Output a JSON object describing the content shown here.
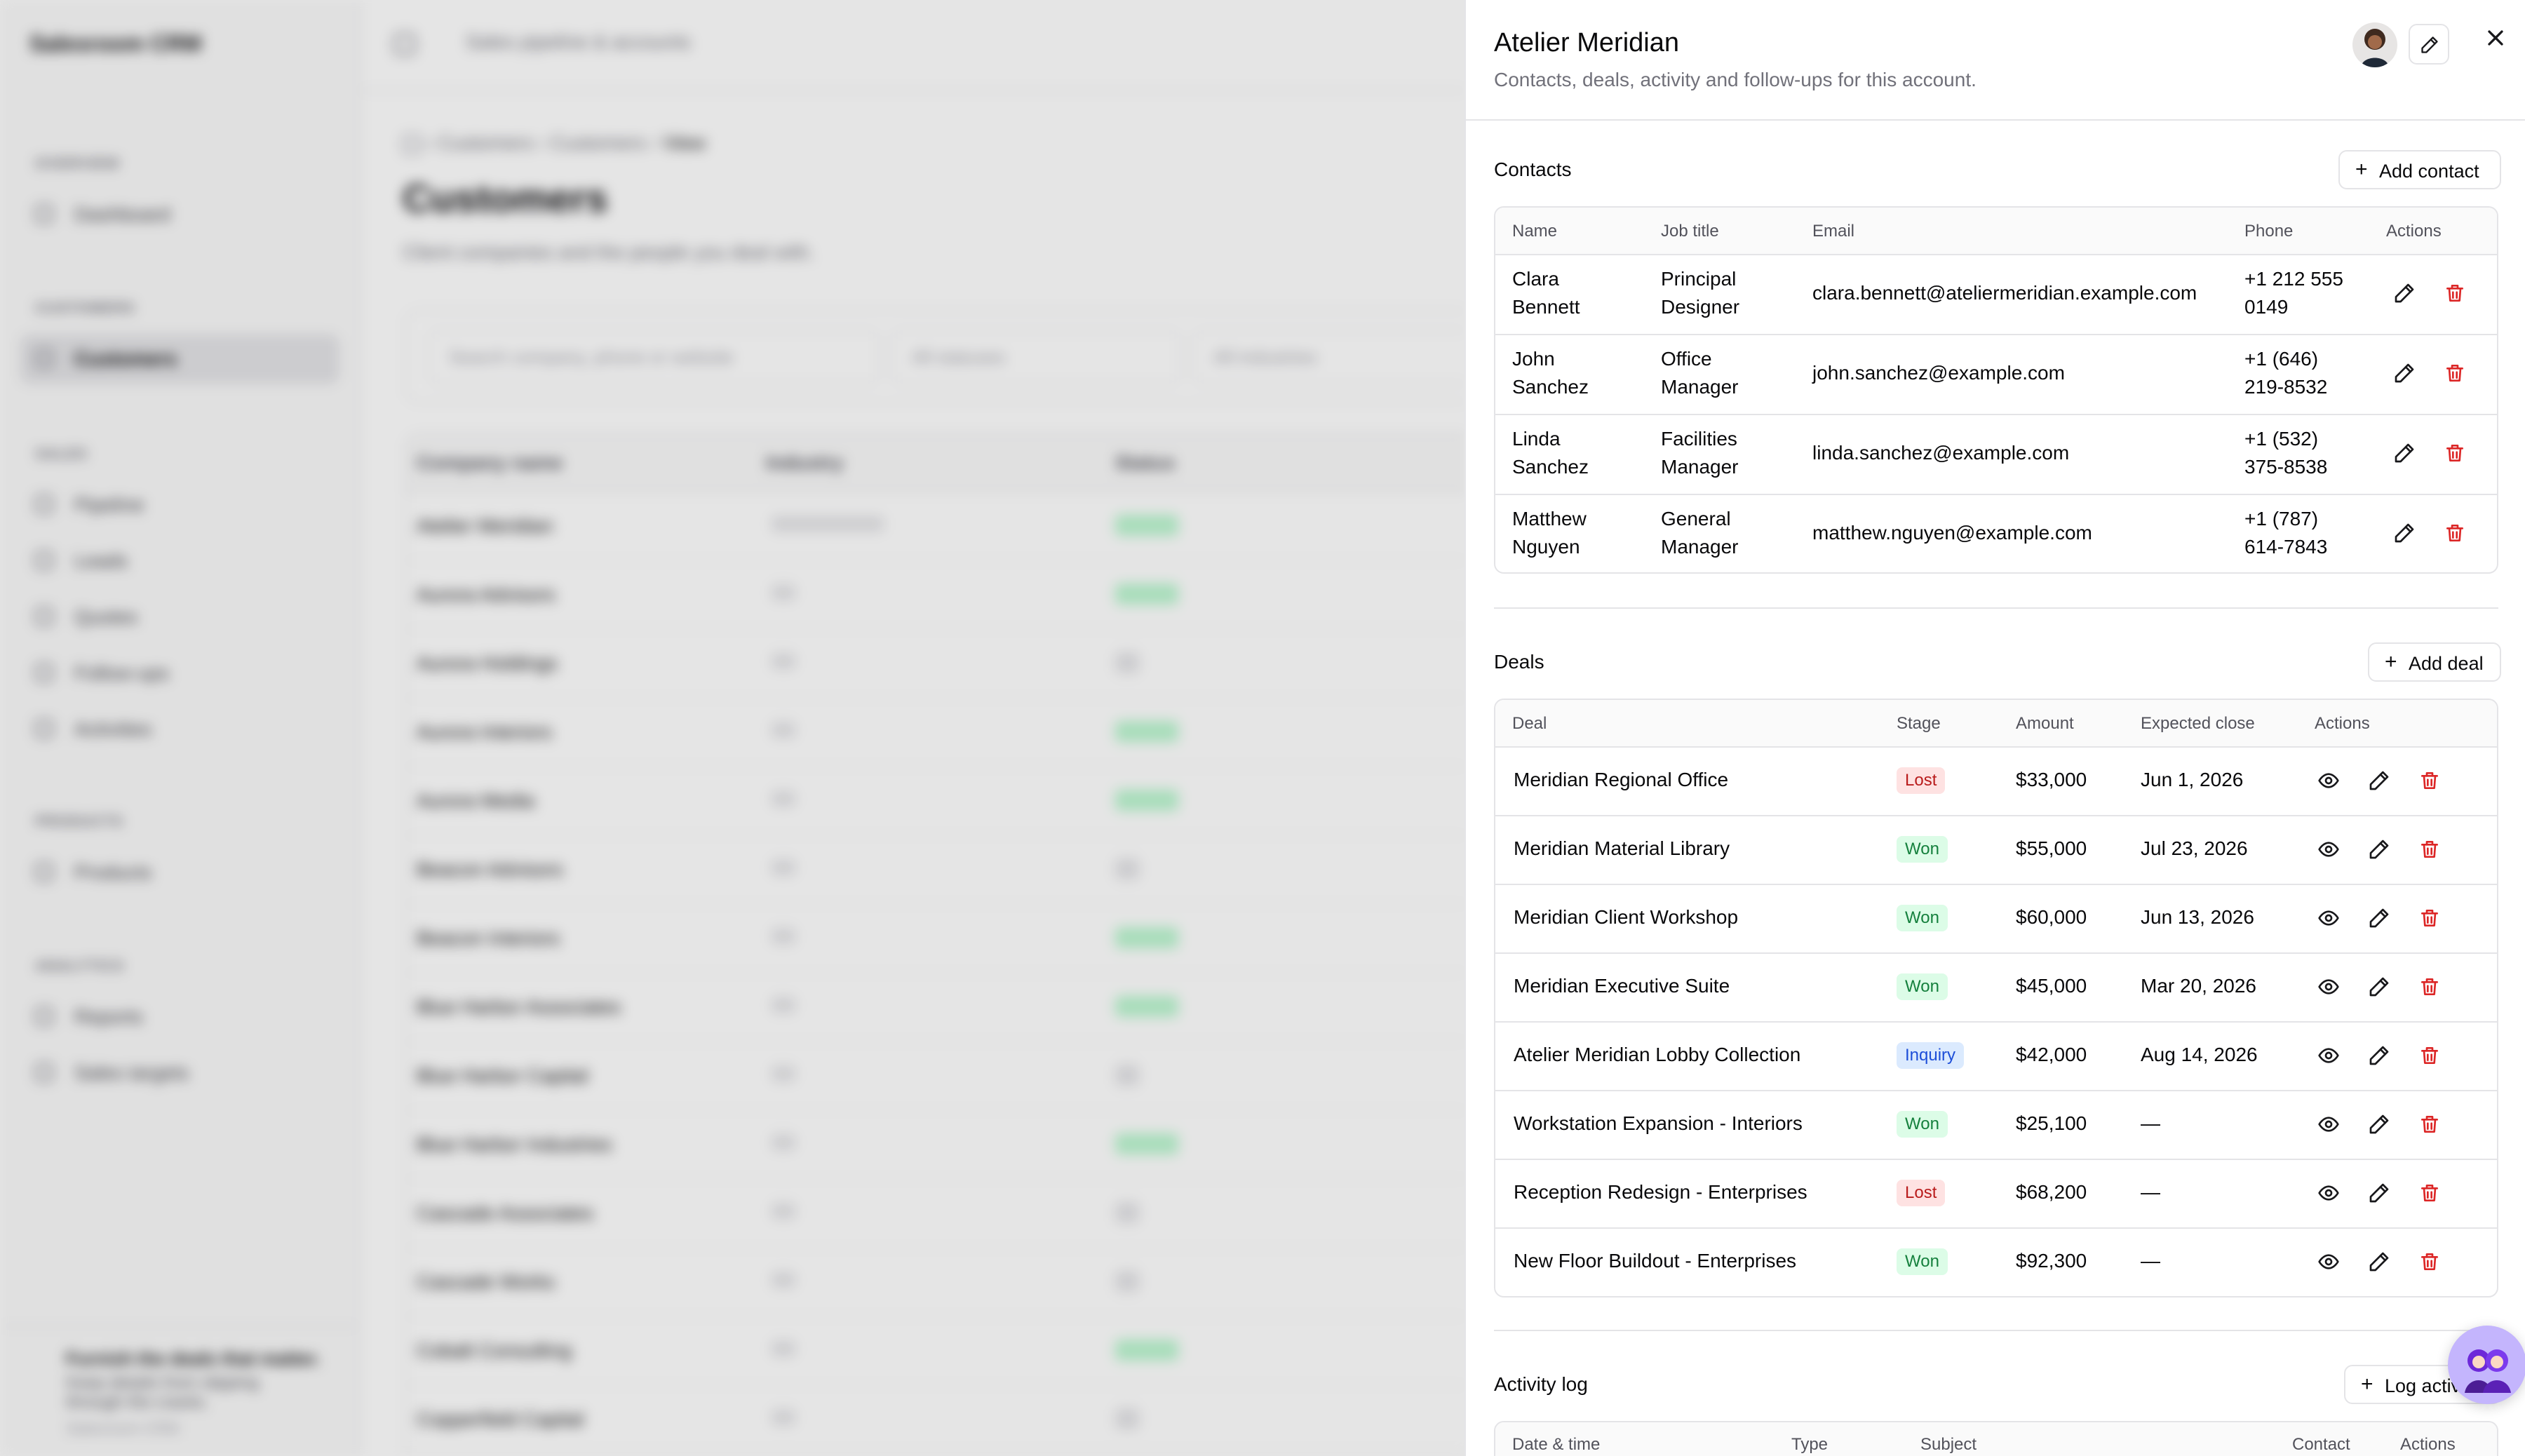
{
  "app": {
    "brand": "Salesroom CRM",
    "topbar_title": "Sales pipeline & accounts",
    "nav": [
      {
        "group": "OVERVIEW",
        "items": [
          {
            "label": "Dashboard",
            "active": false
          }
        ]
      },
      {
        "group": "CUSTOMERS",
        "items": [
          {
            "label": "Customers",
            "active": true
          }
        ]
      },
      {
        "group": "SALES",
        "items": [
          {
            "label": "Pipeline"
          },
          {
            "label": "Leads"
          },
          {
            "label": "Quotes"
          },
          {
            "label": "Follow-ups"
          },
          {
            "label": "Activities"
          }
        ]
      },
      {
        "group": "PRODUCTS",
        "items": [
          {
            "label": "Products"
          }
        ]
      },
      {
        "group": "ANALYTICS",
        "items": [
          {
            "label": "Reports"
          },
          {
            "label": "Sales targets"
          }
        ]
      }
    ],
    "promo": {
      "title": "Furnish the deals that matter.",
      "body": "Keep details from slipping through the cracks.",
      "footer": "Salesroom CRM"
    },
    "breadcrumb": [
      "Customers",
      "Customers",
      "View"
    ],
    "page_title": "Customers",
    "page_subtitle": "Client companies and the people you deal with.",
    "search_placeholder": "Search company, phone or website",
    "filter_status": "All statuses",
    "filter_industry": "All industries",
    "table_headers": [
      "Company name",
      "Industry",
      "Status"
    ],
    "companies": [
      "Atelier Meridian",
      "Aurora Advisors",
      "Aurora Holdings",
      "Aurora Interiors",
      "Aurora Media",
      "Beacon Advisors",
      "Beacon Interiors",
      "Blue Harbor Associates",
      "Blue Harbor Capital",
      "Blue Harbor Industries",
      "Cascade Associates",
      "Cascade Works",
      "Cobalt Consulting",
      "Copperfield Capital"
    ]
  },
  "sheet": {
    "title": "Atelier Meridian",
    "subtitle": "Contacts, deals, activity and follow-ups for this account.",
    "contacts": {
      "title": "Contacts",
      "add_label": "Add contact",
      "headers": {
        "name": "Name",
        "job": "Job title",
        "email": "Email",
        "phone": "Phone",
        "actions": "Actions"
      },
      "rows": [
        {
          "first": "Clara",
          "last": "Bennett",
          "job1": "Principal",
          "job2": "Designer",
          "email": "clara.bennett@ateliermeridian.example.com",
          "phone1": "+1 212 555",
          "phone2": "0149"
        },
        {
          "first": "John",
          "last": "Sanchez",
          "job1": "Office",
          "job2": "Manager",
          "email": "john.sanchez@example.com",
          "phone1": "+1 (646)",
          "phone2": "219-8532"
        },
        {
          "first": "Linda",
          "last": "Sanchez",
          "job1": "Facilities",
          "job2": "Manager",
          "email": "linda.sanchez@example.com",
          "phone1": "+1 (532)",
          "phone2": "375-8538"
        },
        {
          "first": "Matthew",
          "last": "Nguyen",
          "job1": "General",
          "job2": "Manager",
          "email": "matthew.nguyen@example.com",
          "phone1": "+1 (787)",
          "phone2": "614-7843"
        }
      ]
    },
    "deals": {
      "title": "Deals",
      "add_label": "Add deal",
      "headers": {
        "deal": "Deal",
        "stage": "Stage",
        "amount": "Amount",
        "close": "Expected close",
        "actions": "Actions"
      },
      "rows": [
        {
          "deal": "Meridian Regional Office",
          "stage": "Lost",
          "amount": "$33,000",
          "close": "Jun 1, 2026"
        },
        {
          "deal": "Meridian Material Library",
          "stage": "Won",
          "amount": "$55,000",
          "close": "Jul 23, 2026"
        },
        {
          "deal": "Meridian Client Workshop",
          "stage": "Won",
          "amount": "$60,000",
          "close": "Jun 13, 2026"
        },
        {
          "deal": "Meridian Executive Suite",
          "stage": "Won",
          "amount": "$45,000",
          "close": "Mar 20, 2026"
        },
        {
          "deal": "Atelier Meridian Lobby Collection",
          "stage": "Inquiry",
          "amount": "$42,000",
          "close": "Aug 14, 2026"
        },
        {
          "deal": "Workstation Expansion - Interiors",
          "stage": "Won",
          "amount": "$25,100",
          "close": "—"
        },
        {
          "deal": "Reception Redesign - Enterprises",
          "stage": "Lost",
          "amount": "$68,200",
          "close": "—"
        },
        {
          "deal": "New Floor Buildout - Enterprises",
          "stage": "Won",
          "amount": "$92,300",
          "close": "—"
        }
      ]
    },
    "activity": {
      "title": "Activity log",
      "add_label": "Log activity",
      "headers": {
        "date": "Date & time",
        "type": "Type",
        "subject": "Subject",
        "contact": "Contact",
        "actions": "Actions"
      }
    }
  },
  "colors": {
    "danger": "#dc2626",
    "border": "#e4e4e7",
    "muted": "#71717a"
  }
}
